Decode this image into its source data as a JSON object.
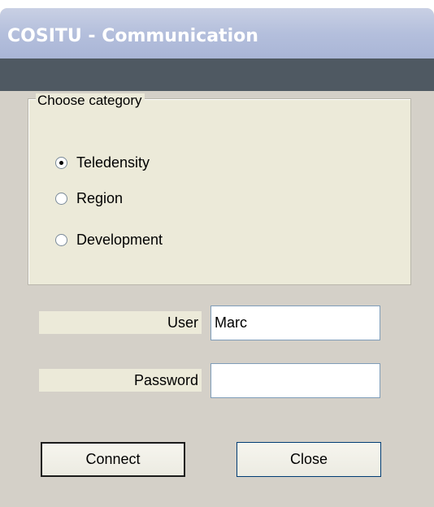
{
  "window": {
    "title": "COSITU - Communication"
  },
  "category": {
    "legend": "Choose category",
    "options": [
      {
        "label": "Teledensity",
        "checked": true
      },
      {
        "label": "Region",
        "checked": false
      },
      {
        "label": "Development",
        "checked": false
      }
    ]
  },
  "form": {
    "user_label": "User",
    "user_value": "Marc",
    "password_label": "Password",
    "password_value": ""
  },
  "buttons": {
    "connect": "Connect",
    "close": "Close"
  },
  "colors": {
    "title_bar": "#b4bfdc",
    "dark_bar": "#4f5962",
    "window_bg": "#d4d0c8",
    "group_bg": "#ecead9"
  }
}
